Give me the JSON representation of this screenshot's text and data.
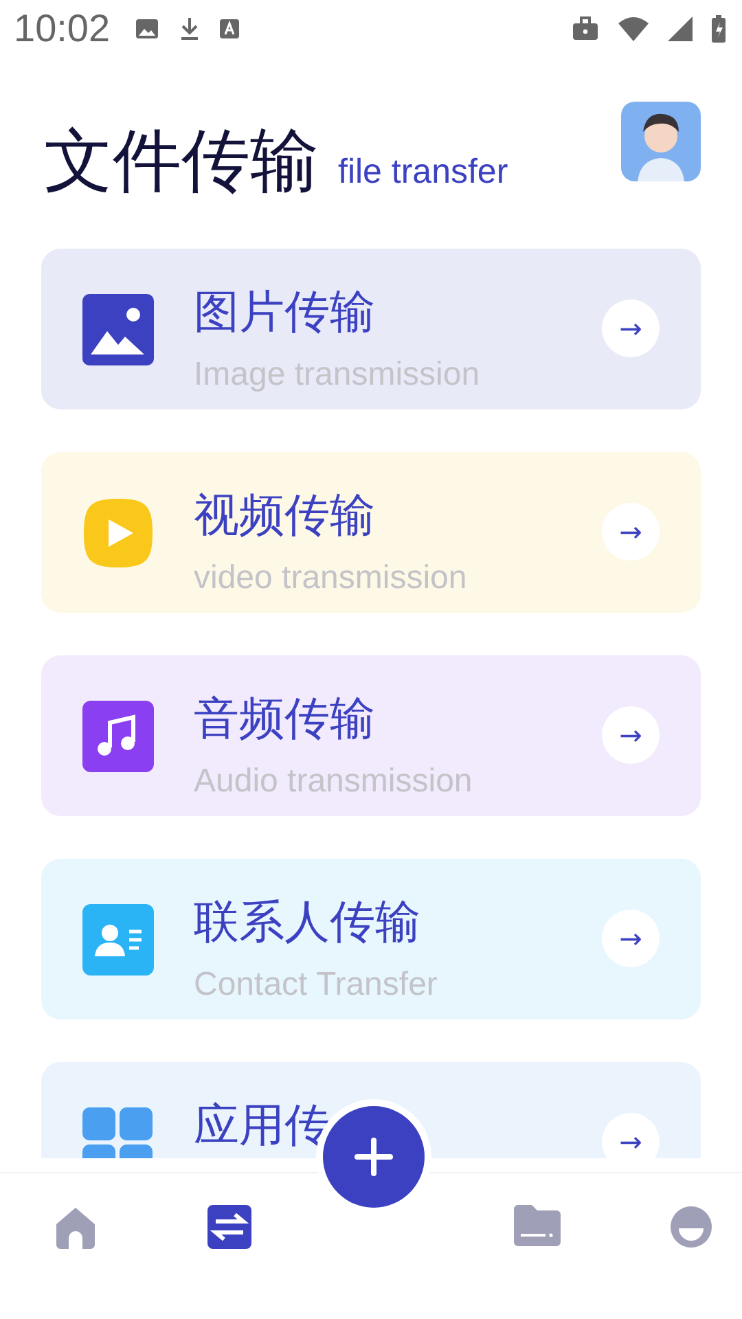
{
  "status_bar": {
    "time": "10:02"
  },
  "header": {
    "title": "文件传输",
    "subtitle": "file transfer"
  },
  "cards": [
    {
      "kind": "image",
      "title": "图片传输",
      "subtitle": "Image transmission",
      "color": "#3b41c0",
      "arrow": "→"
    },
    {
      "kind": "video",
      "title": "视频传输",
      "subtitle": "video transmission",
      "color": "#f9c81a",
      "arrow": "→"
    },
    {
      "kind": "audio",
      "title": "音频传输",
      "subtitle": "Audio transmission",
      "color": "#8a3ff0",
      "arrow": "→"
    },
    {
      "kind": "contact",
      "title": "联系人传输",
      "subtitle": "Contact Transfer",
      "color": "#2bb4f5",
      "arrow": "→"
    },
    {
      "kind": "apps",
      "title": "应用传",
      "color": "#4a9ff0",
      "arrow": "→"
    }
  ],
  "nav": [
    {
      "kind": "home",
      "selected": false
    },
    {
      "kind": "transfer",
      "selected": true
    },
    {
      "kind": "add"
    },
    {
      "kind": "folder",
      "selected": false
    },
    {
      "kind": "profile",
      "selected": false
    }
  ]
}
